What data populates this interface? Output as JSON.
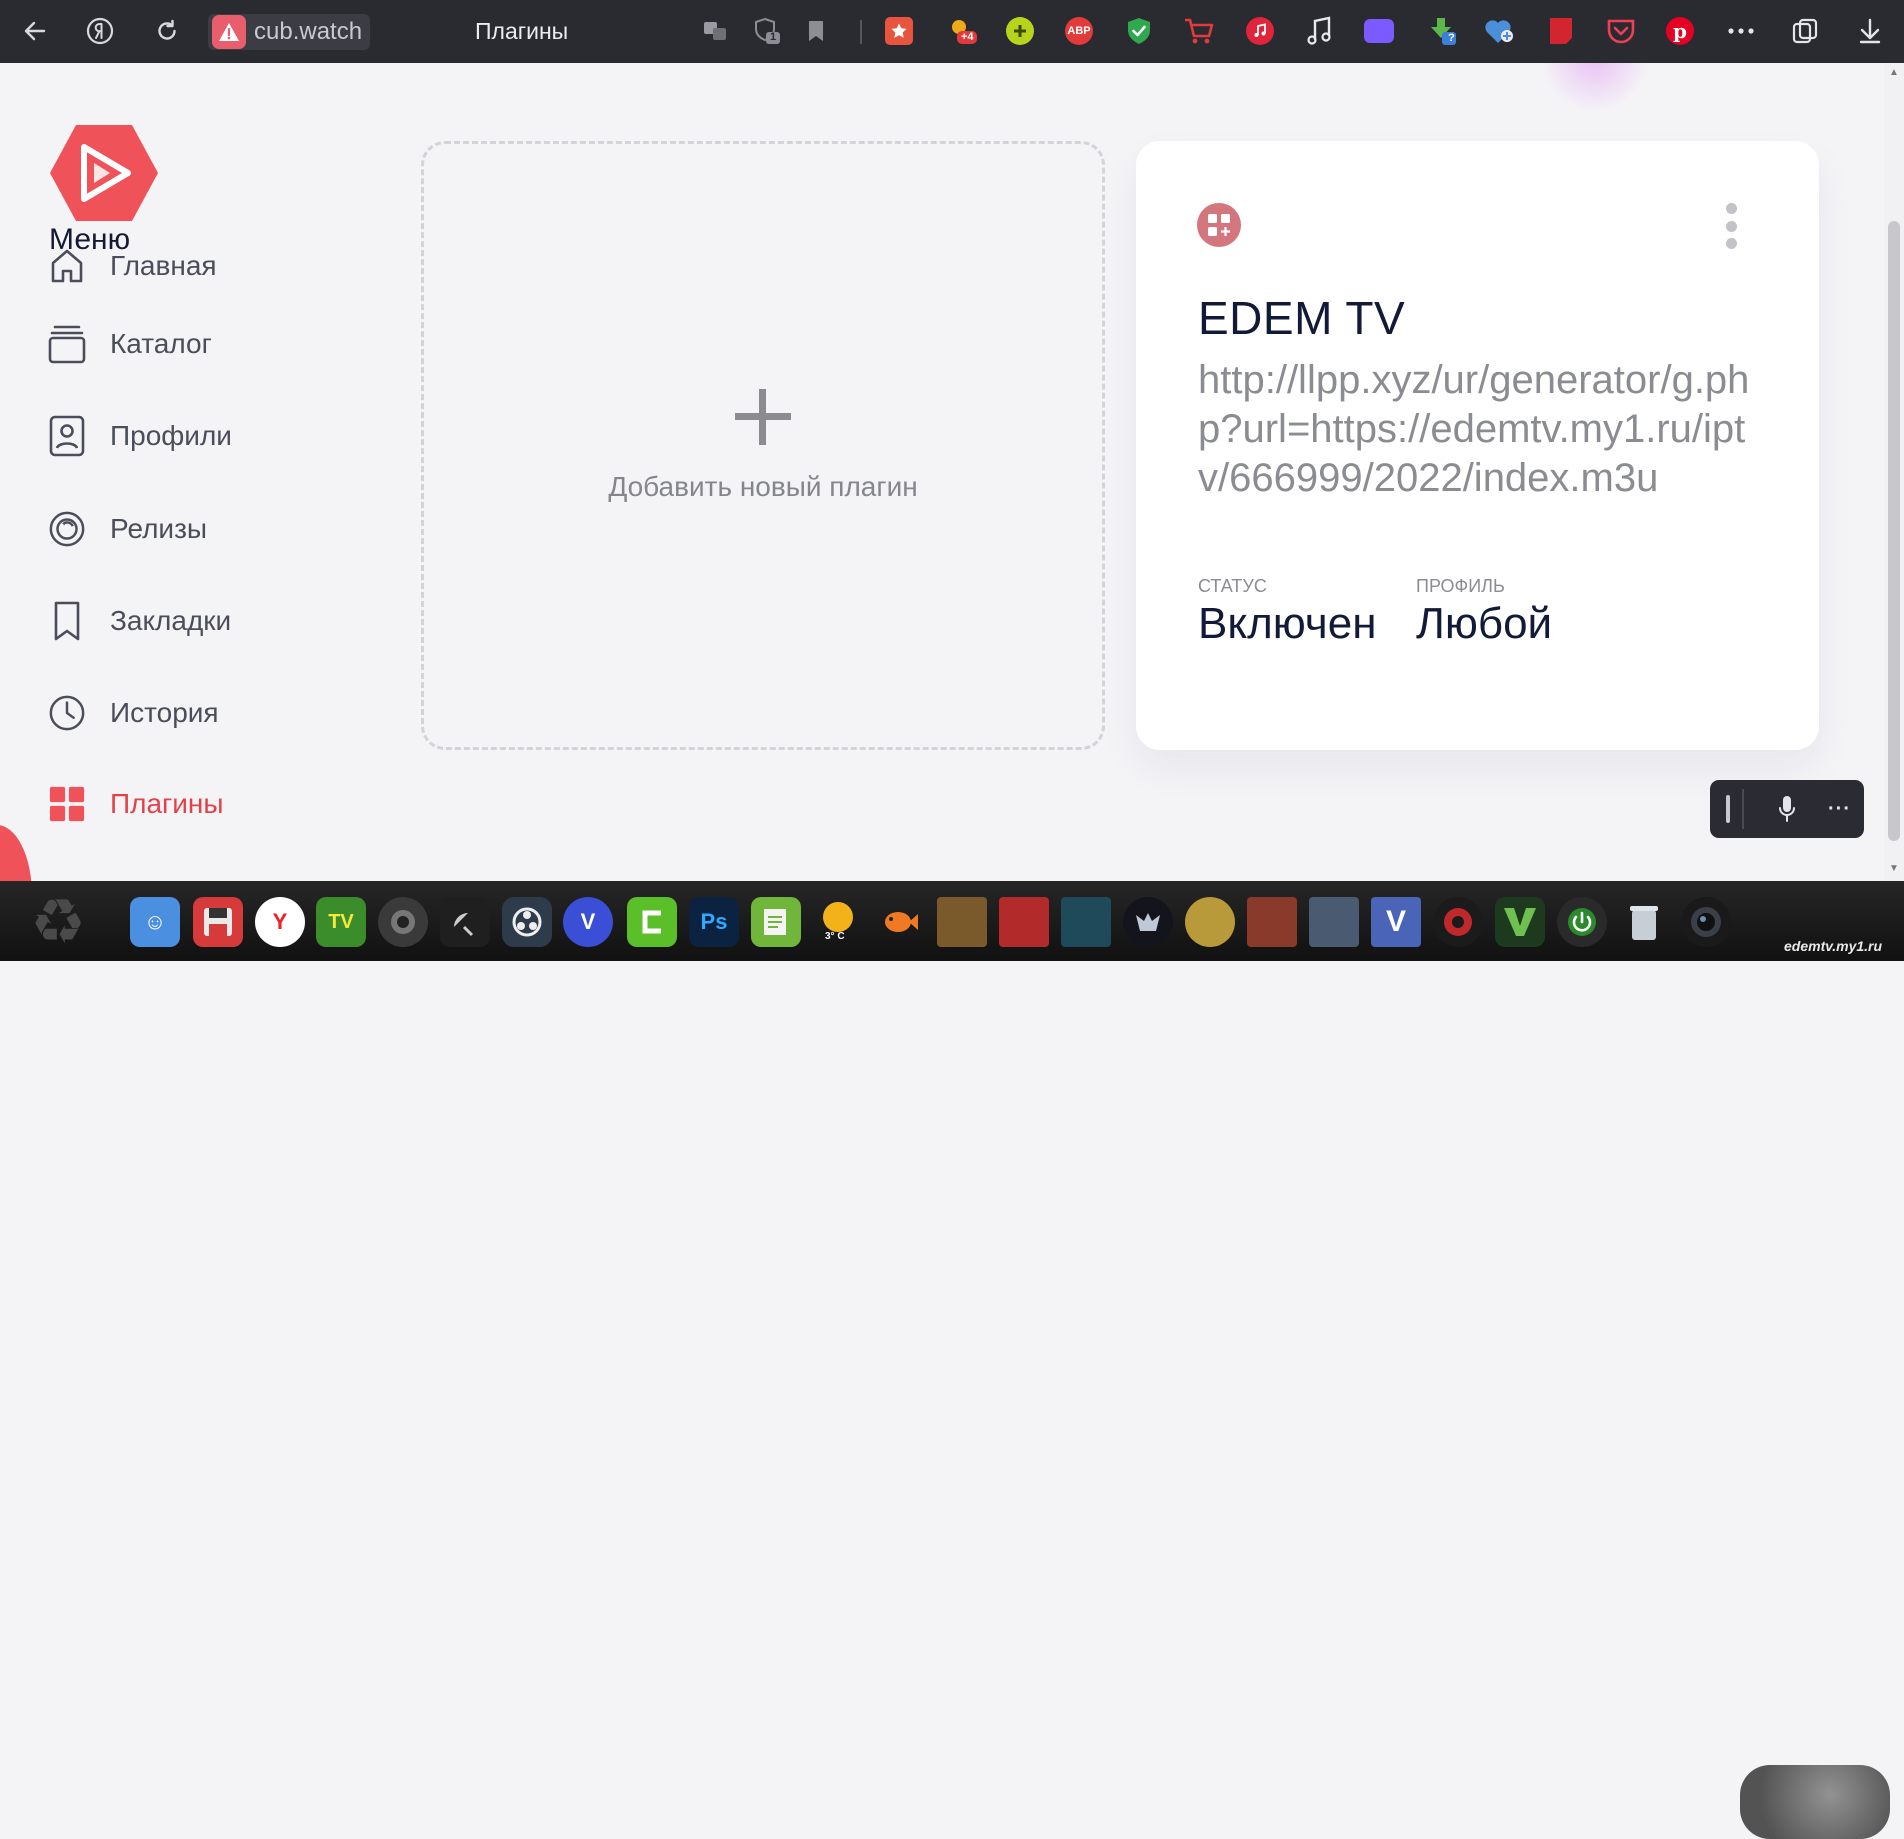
{
  "browser": {
    "site_host": "cub.watch",
    "tab_title": "Плагины",
    "bookmark_badge": "1",
    "weather_badge": "+4",
    "abp_label": "ABP",
    "help_badge": "?"
  },
  "sidebar": {
    "menu_title": "Меню",
    "items": [
      {
        "label": "Главная",
        "icon": "home-icon"
      },
      {
        "label": "Каталог",
        "icon": "catalog-icon"
      },
      {
        "label": "Профили",
        "icon": "profile-icon"
      },
      {
        "label": "Релизы",
        "icon": "releases-icon"
      },
      {
        "label": "Закладки",
        "icon": "bookmark-icon"
      },
      {
        "label": "История",
        "icon": "history-icon"
      },
      {
        "label": "Плагины",
        "icon": "plugins-icon"
      }
    ]
  },
  "add_plugin": {
    "label": "Добавить новый плагин"
  },
  "plugin": {
    "name": "EDEM TV",
    "url": "http://llpp.xyz/ur/generator/g.php?url=https://edemtv.my1.ru/iptv/666999/2022/index.m3u",
    "status_label": "Статус",
    "status_value": "Включен",
    "profile_label": "Профиль",
    "profile_value": "Любой"
  },
  "taskbar": {
    "watermark": "edemtv.my1.ru",
    "weather_text": "3° C",
    "app_labels": {
      "tv": "TV",
      "v": "V",
      "ps": "Ps"
    }
  },
  "colors": {
    "accent": "#f0525a",
    "plugin_icon": "#d3767e",
    "title_text": "#121a38",
    "muted_text": "#8b8c92"
  }
}
